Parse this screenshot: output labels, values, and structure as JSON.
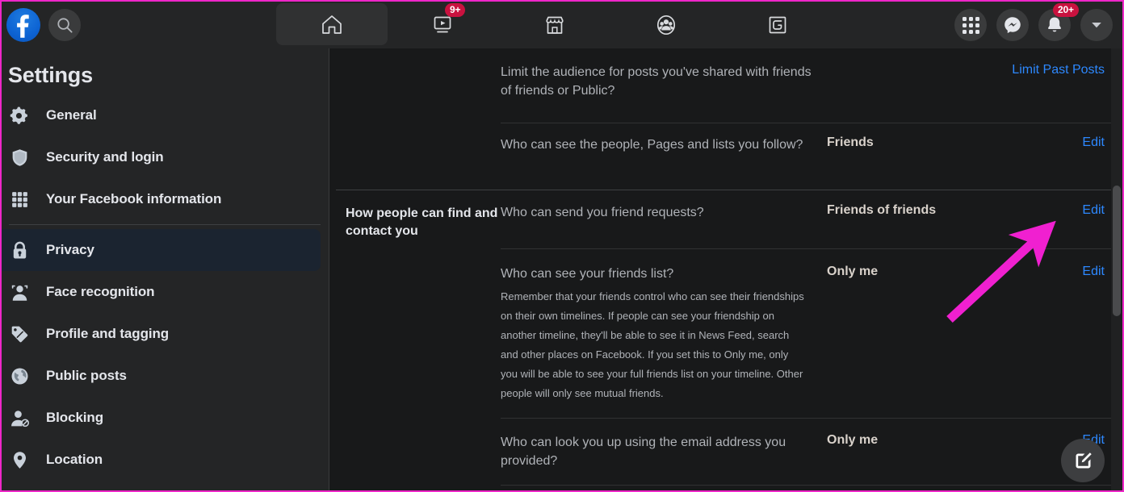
{
  "topbar": {
    "logo_alt": "Facebook",
    "search_placeholder": "Search Facebook",
    "nav_tabs": [
      {
        "name": "home",
        "icon": "home-icon",
        "badge": "",
        "active": true
      },
      {
        "name": "watch",
        "icon": "video-icon",
        "badge": "9+",
        "active": false
      },
      {
        "name": "marketplace",
        "icon": "store-icon",
        "badge": "",
        "active": false
      },
      {
        "name": "groups",
        "icon": "groups-icon",
        "badge": "",
        "active": false
      },
      {
        "name": "gaming",
        "icon": "gaming-icon",
        "badge": "",
        "active": false
      }
    ],
    "right_buttons": [
      {
        "name": "menu",
        "icon": "grid-menu-icon",
        "badge": ""
      },
      {
        "name": "messenger",
        "icon": "messenger-icon",
        "badge": ""
      },
      {
        "name": "notifications",
        "icon": "bell-icon",
        "badge": "20+"
      },
      {
        "name": "account",
        "icon": "chevron-down-icon",
        "badge": ""
      }
    ]
  },
  "sidebar": {
    "title": "Settings",
    "items": [
      {
        "label": "General",
        "icon": "gear-icon",
        "selected": false
      },
      {
        "label": "Security and login",
        "icon": "shield-icon",
        "selected": false
      },
      {
        "label": "Your Facebook information",
        "icon": "grid-icon",
        "selected": false
      },
      {
        "label": "Privacy",
        "icon": "lock-icon",
        "selected": true
      },
      {
        "label": "Face recognition",
        "icon": "face-icon",
        "selected": false
      },
      {
        "label": "Profile and tagging",
        "icon": "tag-icon",
        "selected": false
      },
      {
        "label": "Public posts",
        "icon": "globe-icon",
        "selected": false
      },
      {
        "label": "Blocking",
        "icon": "block-user-icon",
        "selected": false
      },
      {
        "label": "Location",
        "icon": "pin-icon",
        "selected": false
      }
    ]
  },
  "main": {
    "rows": [
      {
        "group_label": "",
        "question": "Limit the audience for posts you've shared with friends of friends or Public?",
        "description": "",
        "value": "",
        "action": "Limit Past Posts"
      },
      {
        "group_label": "",
        "question": "Who can see the people, Pages and lists you follow?",
        "description": "",
        "value": "Friends",
        "action": "Edit"
      },
      {
        "group_label": "How people can find and contact you",
        "question": "Who can send you friend requests?",
        "description": "",
        "value": "Friends of friends",
        "action": "Edit"
      },
      {
        "group_label": "",
        "question": "Who can see your friends list?",
        "description": "Remember that your friends control who can see their friendships on their own timelines. If people can see your friendship on another timeline, they'll be able to see it in News Feed, search and other places on Facebook. If you set this to Only me, only you will be able to see your full friends list on your timeline. Other people will only see mutual friends.",
        "value": "Only me",
        "action": "Edit"
      },
      {
        "group_label": "",
        "question": "Who can look you up using the email address you provided?",
        "description": "",
        "value": "Only me",
        "action": "Edit"
      }
    ],
    "fab_icon": "compose-icon"
  },
  "colors": {
    "accent_link": "#2d88ff",
    "badge_red": "#c9123f",
    "annotation_pink": "#f020d0",
    "brand_blue": "#0d63d3",
    "panel_bg": "#242526",
    "content_bg": "#18191a",
    "selected_bg": "#1b2430"
  }
}
